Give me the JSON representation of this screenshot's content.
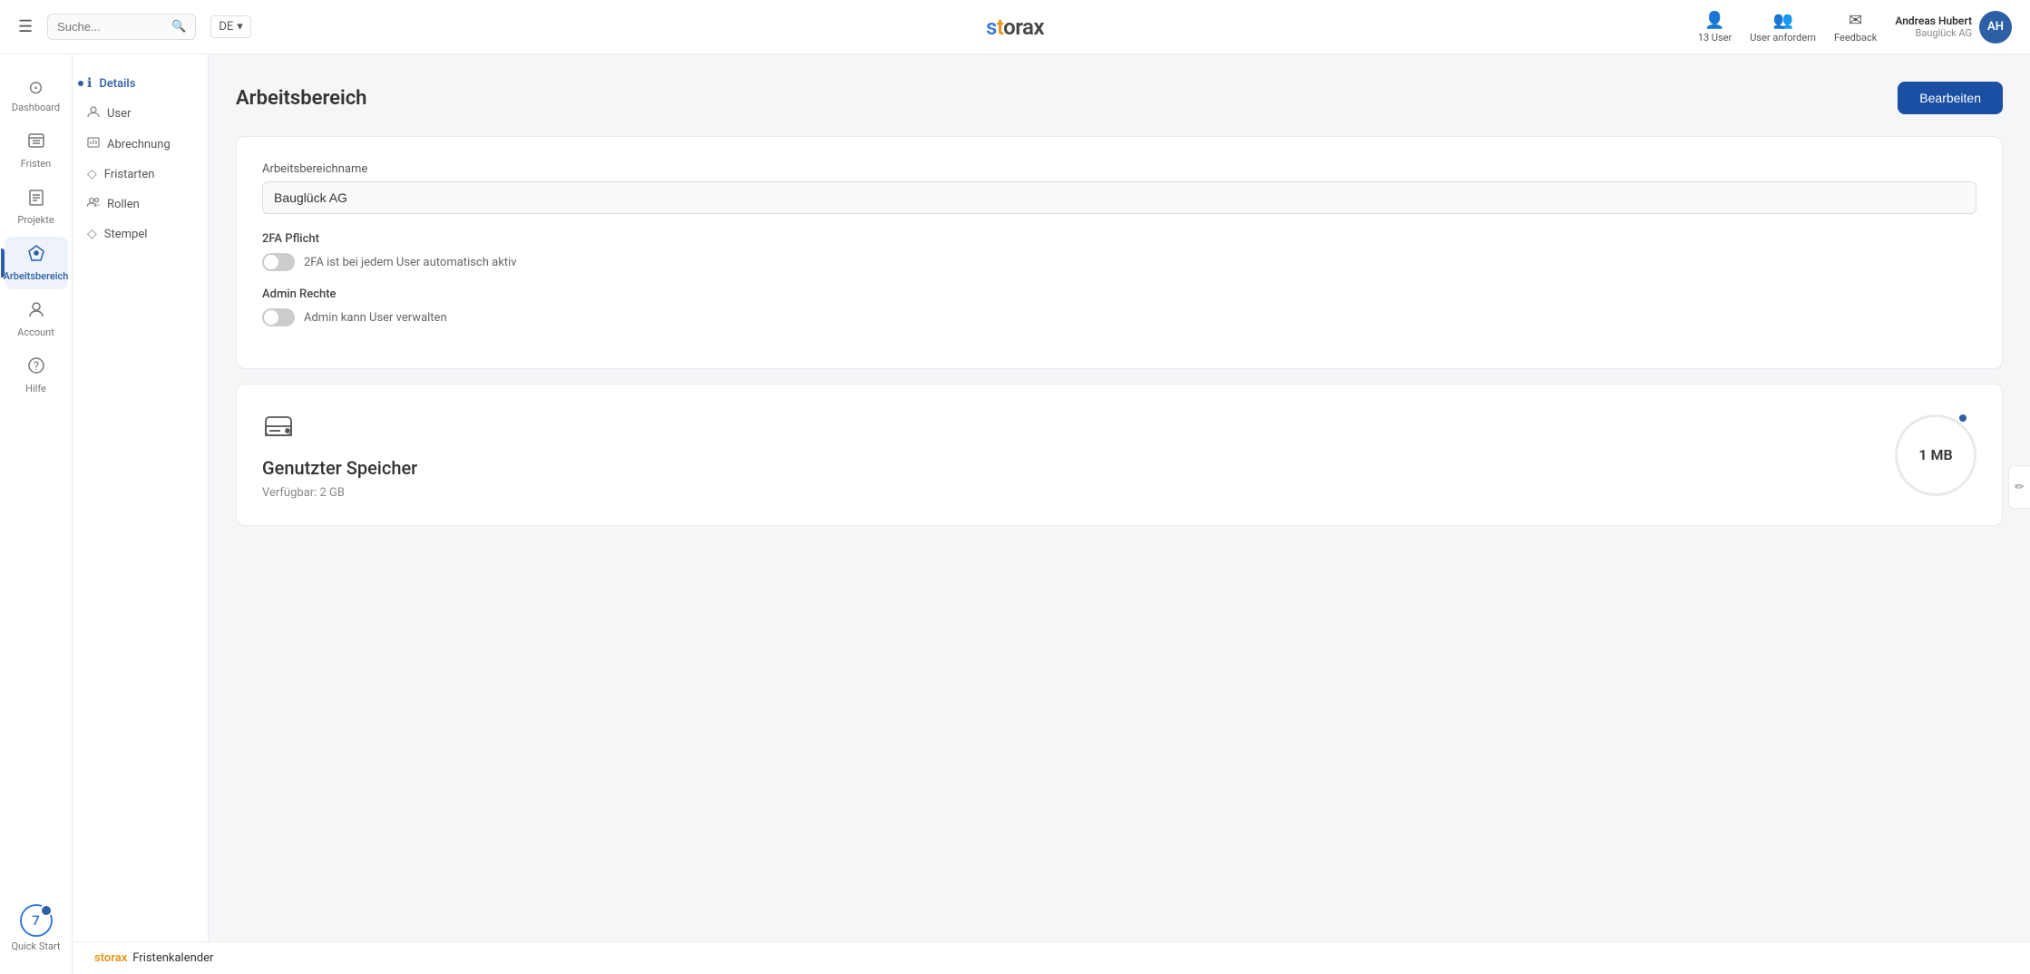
{
  "header": {
    "menu_icon": "☰",
    "search_placeholder": "Suche...",
    "lang": "DE",
    "logo_text": "storax",
    "actions": [
      {
        "id": "users",
        "icon": "👤",
        "label": "13 User"
      },
      {
        "id": "request-user",
        "icon": "👥",
        "label": "User anfordern"
      },
      {
        "id": "feedback",
        "icon": "✉",
        "label": "Feedback"
      }
    ],
    "user": {
      "name": "Andreas Hubert",
      "company": "Bauglück AG",
      "initials": "AH"
    }
  },
  "sidebar": {
    "items": [
      {
        "id": "dashboard",
        "icon": "⊙",
        "label": "Dashboard",
        "active": false
      },
      {
        "id": "fristen",
        "icon": "☰",
        "label": "Fristen",
        "active": false
      },
      {
        "id": "projekte",
        "icon": "📋",
        "label": "Projekte",
        "active": false
      },
      {
        "id": "arbeitsbereich",
        "icon": "🚀",
        "label": "Arbeitsbereich",
        "active": true
      },
      {
        "id": "account",
        "icon": "👤",
        "label": "Account",
        "active": false
      },
      {
        "id": "hilfe",
        "icon": "?",
        "label": "Hilfe",
        "active": false
      }
    ],
    "quick_start": {
      "label": "Quick Start",
      "number": "7"
    }
  },
  "sub_sidebar": {
    "items": [
      {
        "id": "details",
        "icon": "ℹ",
        "label": "Details",
        "active": true
      },
      {
        "id": "user",
        "icon": "👤",
        "label": "User",
        "active": false
      },
      {
        "id": "abrechnung",
        "icon": "📊",
        "label": "Abrechnung",
        "active": false
      },
      {
        "id": "fristarten",
        "icon": "◇",
        "label": "Fristarten",
        "active": false
      },
      {
        "id": "rollen",
        "icon": "👤",
        "label": "Rollen",
        "active": false
      },
      {
        "id": "stempel",
        "icon": "◇",
        "label": "Stempel",
        "active": false
      }
    ]
  },
  "main": {
    "page_title": "Arbeitsbereich",
    "edit_button": "Bearbeiten",
    "workspace_card": {
      "field_label": "Arbeitsbereichname",
      "field_value": "Bauglück AG",
      "twofa_title": "2FA Pflicht",
      "twofa_label": "2FA ist bei jedem User automatisch aktiv",
      "admin_title": "Admin Rechte",
      "admin_label": "Admin kann User verwalten"
    },
    "storage_card": {
      "title": "Genutzter Speicher",
      "available": "Verfügbar: 2 GB",
      "used": "1 MB"
    }
  },
  "footer": {
    "storax": "storax",
    "text": "Fristenkalender"
  }
}
